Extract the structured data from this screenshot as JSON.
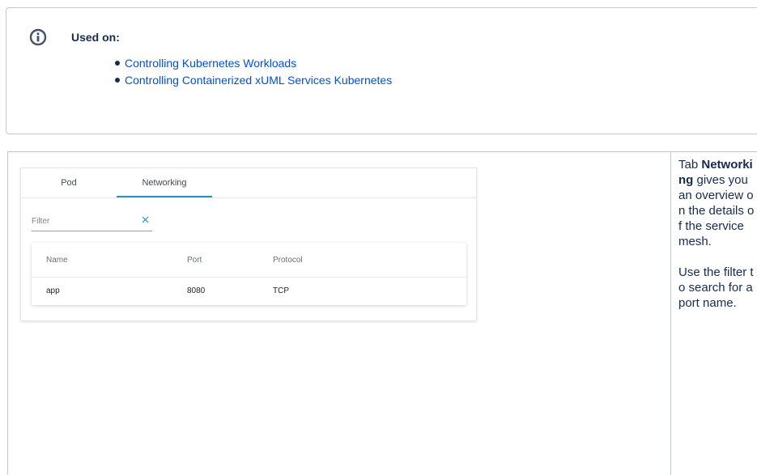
{
  "info_panel": {
    "title": "Used on:",
    "links": [
      "Controlling Kubernetes Workloads",
      "Controlling Containerized xUML Services Kubernetes"
    ]
  },
  "screenshot": {
    "tabs": [
      "Pod",
      "Networking"
    ],
    "active_tab": "Networking",
    "filter_placeholder": "Filter",
    "columns": [
      "Name",
      "Port",
      "Protocol"
    ],
    "rows": [
      [
        "app",
        "8080",
        "TCP"
      ]
    ]
  },
  "description": {
    "p1_prefix": "Tab ",
    "p1_bold": "Networking",
    "p1_suffix": " gives you an overview on the details of the service mesh.",
    "p2": "Use the filter to search for a port name."
  },
  "colors": {
    "link": "#0052cc",
    "active_tab_indicator": "#2a8fbd",
    "border": "#c1c7d0"
  }
}
